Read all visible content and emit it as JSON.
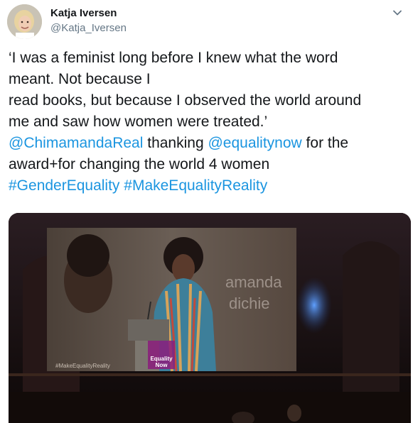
{
  "author": {
    "name": "Katja Iversen",
    "handle": "@Katja_Iversen"
  },
  "tweet": {
    "line1": "‘I was a feminist long before I knew what the word",
    "line2": "meant. Not because I",
    "line3": "read books, but because I observed the world around",
    "line4": "me and saw how women were treated.’",
    "mention1": "@ChimamandaReal",
    "mid_text": " thanking ",
    "mention2": "@equalitynow",
    "end_text": " for the",
    "line6": "award+for changing the world 4 women",
    "hashtag1": "#GenderEquality",
    "hashtag2": "#MakeEqualityReality"
  },
  "media": {
    "screen_name_line1": "amanda",
    "screen_name_line2": "dichie",
    "screen_hashtag": "#MakeEqualityReality",
    "logo_line1": "Equality",
    "logo_line2": "Now"
  },
  "icons": {
    "menu": "chevron-down-icon"
  },
  "colors": {
    "link": "#1b95e0",
    "text": "#14171a",
    "secondary": "#657786"
  }
}
